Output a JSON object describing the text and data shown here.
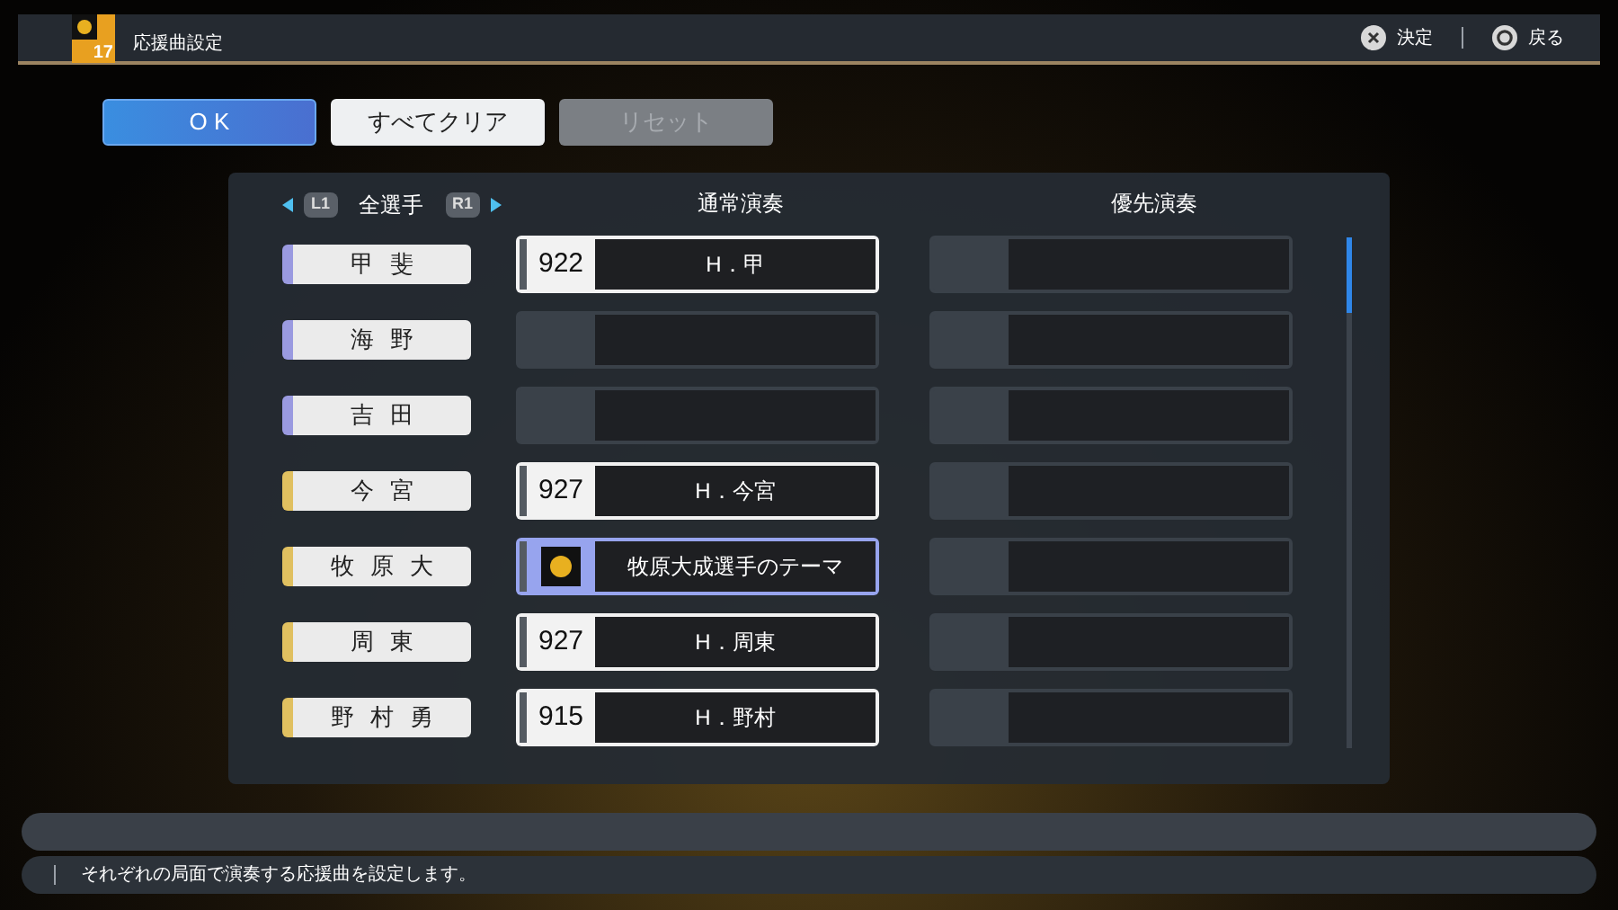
{
  "header": {
    "badge_number": "17",
    "title": "応援曲設定",
    "hints": [
      {
        "kind": "cross",
        "label": "決定"
      },
      {
        "kind": "circle",
        "label": "戻る"
      }
    ]
  },
  "buttons": [
    {
      "label": "O K",
      "kind": "primary"
    },
    {
      "label": "すべてクリア",
      "kind": "normal"
    },
    {
      "label": "リセット",
      "kind": "disabled"
    }
  ],
  "table": {
    "filter": {
      "left_key": "L1",
      "label": "全選手",
      "right_key": "R1"
    },
    "columns": [
      "通常演奏",
      "優先演奏"
    ],
    "rows": [
      {
        "player": "甲斐",
        "color": "#9a9ae0",
        "normal": {
          "kind": "numbered",
          "number": "922",
          "song": "H．甲",
          "selected": false
        },
        "priority": {
          "kind": "empty",
          "selected": false
        }
      },
      {
        "player": "海野",
        "color": "#9a9ae0",
        "normal": {
          "kind": "empty",
          "selected": false
        },
        "priority": {
          "kind": "empty",
          "selected": false
        }
      },
      {
        "player": "吉田",
        "color": "#9a9ae0",
        "normal": {
          "kind": "empty",
          "selected": false
        },
        "priority": {
          "kind": "empty",
          "selected": false
        }
      },
      {
        "player": "今宮",
        "color": "#e0c060",
        "normal": {
          "kind": "numbered",
          "number": "927",
          "song": "H．今宮",
          "selected": false
        },
        "priority": {
          "kind": "empty",
          "selected": false
        }
      },
      {
        "player": "牧原大",
        "color": "#e0c060",
        "normal": {
          "kind": "logo",
          "song": "牧原大成選手のテーマ",
          "selected": true
        },
        "priority": {
          "kind": "empty",
          "selected": false
        }
      },
      {
        "player": "周東",
        "color": "#e0c060",
        "normal": {
          "kind": "numbered",
          "number": "927",
          "song": "H．周東",
          "selected": false
        },
        "priority": {
          "kind": "empty",
          "selected": false
        }
      },
      {
        "player": "野村勇",
        "color": "#e0c060",
        "normal": {
          "kind": "numbered",
          "number": "915",
          "song": "H．野村",
          "selected": false
        },
        "priority": {
          "kind": "empty",
          "selected": false
        }
      }
    ]
  },
  "help_text": "それぞれの局面で演奏する応援曲を設定します。"
}
